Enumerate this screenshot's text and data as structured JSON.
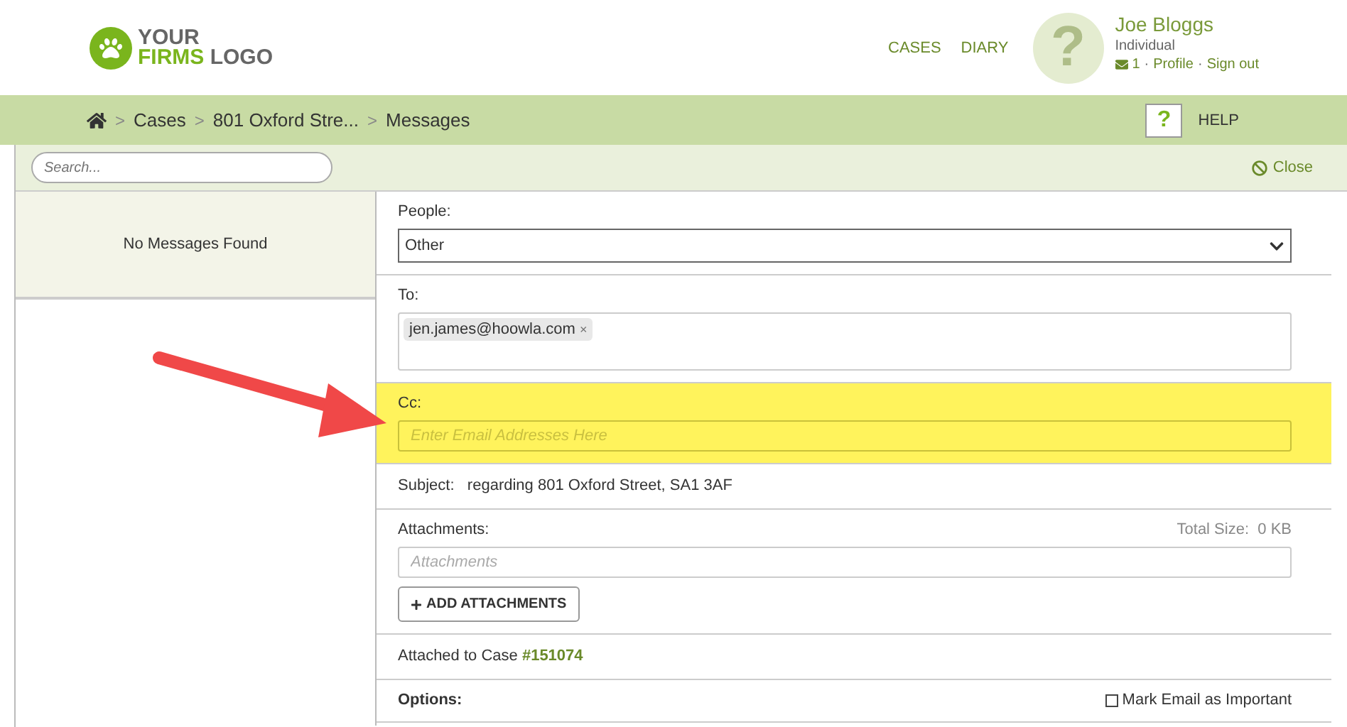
{
  "logo": {
    "line_1": "YOUR",
    "line_2a": "FIRMS",
    "line_2b": "LOGO"
  },
  "nav": [
    {
      "label": "CASES"
    },
    {
      "label": "DIARY"
    }
  ],
  "user": {
    "avatar_glyph": "?",
    "name": "Joe Bloggs",
    "role": "Individual",
    "message_count": "1",
    "links": [
      "Profile",
      "Sign out"
    ],
    "link_separator": "·"
  },
  "breadcrumb_separator": ">",
  "breadcrumb": [
    "Cases",
    "801 Oxford Stre...",
    "Messages"
  ],
  "help": {
    "glyph": "?",
    "label": "HELP"
  },
  "search": {
    "placeholder": "Search..."
  },
  "close": {
    "label": "Close"
  },
  "message_list": {
    "empty_text": "No Messages Found"
  },
  "form": {
    "people": {
      "label": "People:",
      "value": "Other"
    },
    "to": {
      "label": "To:",
      "recipients": [
        "jen.james@hoowla.com"
      ],
      "remove_glyph": "×"
    },
    "cc": {
      "label": "Cc:",
      "placeholder": "Enter Email Addresses Here",
      "highlighted": true
    },
    "subject": {
      "label": "Subject:",
      "value": "regarding 801 Oxford Street, SA1 3AF"
    },
    "attachments": {
      "label": "Attachments:",
      "total_size_label": "Total Size:",
      "total_size": "0 KB",
      "placeholder": "Attachments",
      "button": "ADD ATTACHMENTS"
    },
    "case": {
      "label": "Attached to Case",
      "number": "#151074"
    },
    "options": {
      "label": "Options:",
      "important_label": "Mark Email as Important",
      "important_checked": false
    }
  },
  "annotation": {
    "kind": "arrow"
  }
}
